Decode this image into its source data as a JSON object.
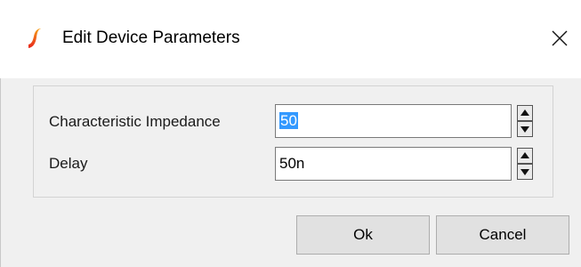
{
  "window": {
    "title": "Edit Device Parameters",
    "app_icon": "ltspice-logo-icon",
    "close_icon": "close-icon",
    "accent_color": "#e8241c"
  },
  "fields": [
    {
      "label": "Characteristic Impedance",
      "value": "50",
      "selected": true,
      "spinner_up_icon": "triangle-up-icon",
      "spinner_down_icon": "triangle-down-icon"
    },
    {
      "label": "Delay",
      "value": "50n",
      "selected": false,
      "spinner_up_icon": "triangle-up-icon",
      "spinner_down_icon": "triangle-down-icon"
    }
  ],
  "buttons": {
    "ok_label": "Ok",
    "cancel_label": "Cancel"
  },
  "colors": {
    "selection": "#3399ff",
    "button_face": "#e1e1e1",
    "dialog_background": "#f0f0f0"
  }
}
